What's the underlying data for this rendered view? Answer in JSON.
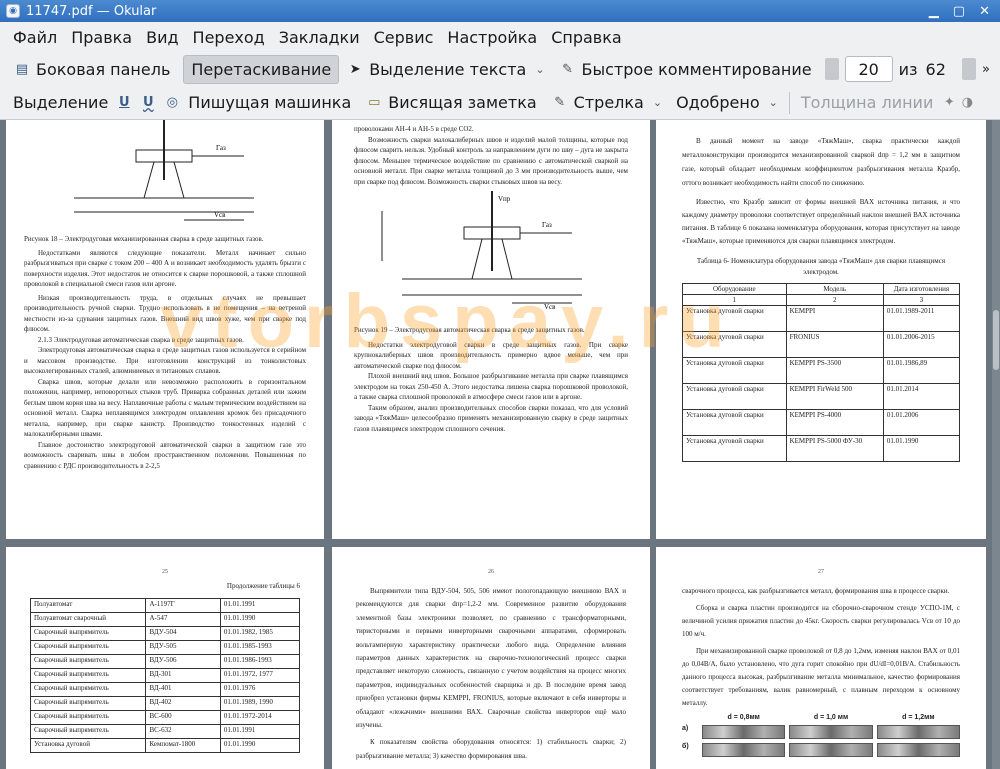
{
  "window": {
    "title": "11747.pdf — Okular"
  },
  "menu": [
    "Файл",
    "Правка",
    "Вид",
    "Переход",
    "Закладки",
    "Сервис",
    "Настройка",
    "Справка"
  ],
  "toolbar1": {
    "sidebar": "Боковая панель",
    "drag": "Перетаскивание",
    "text_select": "Выделение текста",
    "quick_comment": "Быстрое комментирование",
    "page_current": "20",
    "page_of": "из",
    "page_total": "62"
  },
  "toolbar2": {
    "select": "Выделение",
    "typewriter": "Пишущая машинка",
    "note": "Висящая заметка",
    "arrow": "Стрелка",
    "approved": "Одобрено",
    "line_width": "Толщина линии"
  },
  "watermark": "vtorbspay.ru",
  "pages": {
    "p1": {
      "fig_labels": [
        "Газ",
        "Vсв"
      ],
      "caption": "Рисунок 18 – Электродуговая механизированная сварка в среде защитных газов.",
      "paragraphs": [
        "Недостатками являются следующие показатели. Металл начинает сильно разбрызгиваться при сварке с током 200 – 400 А и возникает необходимость удалять брызги с поверхности изделия. Этот недостаток не относится к сварке порошковой, а также сплошной проволокой в специальной смеси газов или аргоне.",
        "Низкая производительность труда, в отдельных случаях не превышает производительность ручной сварки. Трудно использовать в не помещения – на ветреной местности из-за сдувания защитных газов. Внешний вид швов хуже, чем при сварке под флюсом.",
        "2.1.3 Электродуговая автоматическая сварка в среде защитных газов.",
        "Электродуговая автоматическая сварка в среде защитных газов используется в серийном и массовом производстве. При изготовлении конструкций из тонколистовых высоколегированных сталей, алюминиевых и титановых сплавов.",
        "Сварка швов, которые делали или невозможно расположить в горизонтальном положении, например, неповоротных стыков труб. Приварка собранных деталей или зажим беглым швом корня шва на весу. Наплавочные работы с малым термическим воздействием на основной металл. Сварка неплавящимся электродом оплавления кромок без присадочного металла, например, при сварке канистр. Производство тонкостенных изделий с малокалиберными швами.",
        "Главное достоинство электродуговой автоматической сварки в защитном газе это возможность сваривать швы в любом пространственном положении. Повышенная по сравнению с РДС производительность в 2-2,5"
      ]
    },
    "p2": {
      "top": "проволоками АН-4 и АН-5 в среде СО2.",
      "para1": "Возможность сварки малокалиберных швов и изделий малой толщины, которые под флюсом сварить нельзя. Удобный контроль за направлением дуги по шву – дуга не закрыта флюсом. Меньшее термическое воздействие по сравнению с автоматической сваркой на основной металл. При сварке металла толщиной до 3 мм производительность выше, чем при сварке под флюсом. Возможность сварки стыковых швов на весу.",
      "fig_labels": [
        "Vпр",
        "Газ",
        "Vсв"
      ],
      "caption": "Рисунок 19 – Электродуговая автоматическая сварка в среде защитных газов.",
      "paragraphs": [
        "Недостатки электродуговой сварки в среде защитных газов. При сварке крупнокалиберных швов производительность примерно вдвое меньше, чем при автоматической сварке под флюсом.",
        "Плохой внешний вид швов. Большое разбрызгивание металла при сварке плавящимся электродом на токах 250-450 А. Этого недостатка лишена сварка порошковой проволокой, а также сварка сплошной проволокой в атмосфере смеси газов или в аргоне.",
        "Таким образом, анализ производительных способов сварки показал, что для условий завода «ТяжМаш» целесообразно применять механизированную сварку в среде защитных газов плавящимся электродом сплошного сечения."
      ]
    },
    "p3": {
      "paragraphs": [
        "В данный момент на заводе «ТяжМаш», сварка практически каждой металлоконструкции производится механизированной сваркой dпр = 1,2 мм в защитном газе, который обладает необходимым коэффициентом разбрызгивания металла Кразбр, оттого возникает необходимость найти способ по снижению.",
        "Известно, что Кразбр зависит от формы внешней ВАХ источника питания, и что каждому диаметру проволоки соответствует определённый наклон внешней ВАХ источника питания. В таблице 6 показана номенклатура оборудования, которая присутствует на заводе «ТяжМаш», которые применяются для сварки плавящимся электродом."
      ],
      "table_title": "Таблица 6- Номенклатура оборудования завода «ТяжМаш» для сварки плавящимся электродом.",
      "table_headers": [
        "Оборудование",
        "Модель",
        "Дата изготовления"
      ],
      "table_nums": [
        "1",
        "2",
        "3"
      ],
      "table_rows": [
        [
          "Установка дуговой сварки",
          "KEMPPI",
          "01.01.1989-2011"
        ],
        [
          "Установка дуговой сварки",
          "FRONIUS",
          "01.01.2006-2015"
        ],
        [
          "Установка дуговой сварки",
          "KEMPPI PS-3500",
          "01.01.1986,89"
        ],
        [
          "Установка дуговой сварки",
          "KEMPPI FirWeld 500",
          "01.01.2014"
        ],
        [
          "Установка дуговой сварки",
          "KEMPPI PS-4000",
          "01.01.2006"
        ],
        [
          "Установка дуговой сварки",
          "KEMPPI PS-5000 ФУ-30",
          "01.01.1990"
        ]
      ]
    },
    "p4": {
      "number": "25",
      "continuation": "Продолжение таблицы 6",
      "rows": [
        [
          "Полуавтомат",
          "А-1197Г",
          "01.01.1991"
        ],
        [
          "Полуавтомат сварочный",
          "А-547",
          "01.01.1990"
        ],
        [
          "Сварочный выпрямитель",
          "ВДУ-504",
          "01.01.1982, 1985"
        ],
        [
          "Сварочный выпрямитель",
          "ВДУ-505",
          "01.01.1985-1993"
        ],
        [
          "Сварочный выпрямитель",
          "ВДУ-506",
          "01.01.1986-1993"
        ],
        [
          "Сварочный выпрямитель",
          "ВД-301",
          "01.01.1972, 1977"
        ],
        [
          "Сварочный выпрямитель",
          "ВД-401",
          "01.01.1976"
        ],
        [
          "Сварочный выпрямитель",
          "ВД-402",
          "01.01.1989, 1990"
        ],
        [
          "Сварочный выпрямитель",
          "ВС-600",
          "01.01.1972-2014"
        ],
        [
          "Сварочный выпрямитель",
          "ВС-632",
          "01.01.1991"
        ],
        [
          "Установка дуговой",
          "Кемпомат-1800",
          "01.01.1990"
        ]
      ]
    },
    "p5": {
      "number": "26",
      "paragraphs": [
        "Выпрямители типа ВДУ-504, 505, 506 имеют пологопадающую внешнюю ВАХ и рекомендуются для сварки dпр=1,2-2 мм. Современное развитие оборудования элементной базы электроники позволяет, по сравнению с трансформаторными, тиристорными и первыми инверторными сварочными аппаратами, сформировать вольтамперную характеристику практически любого вида. Определение влияния параметров данных характеристик на сварочно-технологический процесс сварки представляет некоторую сложность, связанную с учетом воздействия на процесс многих параметров, индивидуальных особенностей сварщика и др. В последние время завод приобрел установки фирмы KEMPPI, FRONIUS, которые включают в себя инверторы и обладают «лежачими» внешними ВАХ. Сварочные свойства инверторов ещё мало изучены.",
        "К показателям свойства оборудования относятся: 1) стабильность сварки; 2) разбрызгивание металла; 3) качество формирования шва."
      ]
    },
    "p6": {
      "number": "27",
      "paragraphs": [
        "сварочного процесса, как разбрызгивается металл, формирования шва в процессе сварки.",
        "Сборка и сварка пластин производится на сборочно-сварочном стенде УСПО-1М, с величиной усилия прижатия пластин до 45кг. Скорость сварки регулировалась Vсв от 10 до 100 м/ч.",
        "При механизированной сварке проволокой от 0,8 до 1,2мм, изменяя наклон ВАХ от 0,01 до 0,04В/А, было установлено, что дуга горит спокойно при dU/dI=0,01В/А. Стабильность данного процесса высокая, разбрызгивание металла минимальное, качество формирования соответствует требованиям, валик равномерный, с плавным переходом к основному металлу."
      ],
      "photo_headers": [
        "d = 0,8мм",
        "d = 1,0 мм",
        "d = 1,2мм"
      ],
      "photo_rows": [
        "а)",
        "б)"
      ]
    }
  }
}
